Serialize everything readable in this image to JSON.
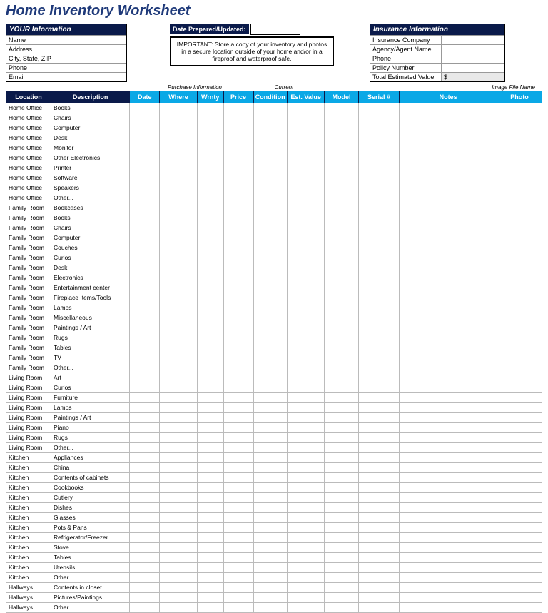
{
  "title": "Home Inventory Worksheet",
  "your_info": {
    "header": "YOUR Information",
    "rows": [
      {
        "label": "Name",
        "value": ""
      },
      {
        "label": "Address",
        "value": ""
      },
      {
        "label": "City, State, ZIP",
        "value": ""
      },
      {
        "label": "Phone",
        "value": ""
      },
      {
        "label": "Email",
        "value": ""
      }
    ]
  },
  "date_prepared_label": "Date Prepared/Updated:",
  "important": "IMPORTANT: Store a copy of your inventory and photos in a secure location outside of your home and/or in a fireproof and waterproof safe.",
  "insurance": {
    "header": "Insurance Information",
    "rows": [
      {
        "label": "Insurance Company",
        "value": ""
      },
      {
        "label": "Agency/Agent Name",
        "value": ""
      },
      {
        "label": "Phone",
        "value": ""
      },
      {
        "label": "Policy Number",
        "value": ""
      },
      {
        "label": "Total Estimated Value",
        "value": "$"
      }
    ]
  },
  "section_labels": {
    "purchase": "Purchase Information",
    "current": "Current",
    "image": "Image File Name"
  },
  "columns": [
    "Location",
    "Description",
    "Date",
    "Where",
    "Wrnty",
    "Price",
    "Condition",
    "Est. Value",
    "Model",
    "Serial #",
    "Notes",
    "Photo"
  ],
  "rows": [
    {
      "loc": "Home Office",
      "desc": "Books"
    },
    {
      "loc": "Home Office",
      "desc": "Chairs"
    },
    {
      "loc": "Home Office",
      "desc": "Computer"
    },
    {
      "loc": "Home Office",
      "desc": "Desk"
    },
    {
      "loc": "Home Office",
      "desc": "Monitor"
    },
    {
      "loc": "Home Office",
      "desc": "Other Electronics"
    },
    {
      "loc": "Home Office",
      "desc": "Printer"
    },
    {
      "loc": "Home Office",
      "desc": "Software"
    },
    {
      "loc": "Home Office",
      "desc": "Speakers"
    },
    {
      "loc": "Home Office",
      "desc": "Other..."
    },
    {
      "loc": "Family Room",
      "desc": "Bookcases"
    },
    {
      "loc": "Family Room",
      "desc": "Books"
    },
    {
      "loc": "Family Room",
      "desc": "Chairs"
    },
    {
      "loc": "Family Room",
      "desc": "Computer"
    },
    {
      "loc": "Family Room",
      "desc": "Couches"
    },
    {
      "loc": "Family Room",
      "desc": "Curios"
    },
    {
      "loc": "Family Room",
      "desc": "Desk"
    },
    {
      "loc": "Family Room",
      "desc": "Electronics"
    },
    {
      "loc": "Family Room",
      "desc": "Entertainment center"
    },
    {
      "loc": "Family Room",
      "desc": "Fireplace Items/Tools"
    },
    {
      "loc": "Family Room",
      "desc": "Lamps"
    },
    {
      "loc": "Family Room",
      "desc": "Miscellaneous"
    },
    {
      "loc": "Family Room",
      "desc": "Paintings / Art"
    },
    {
      "loc": "Family Room",
      "desc": "Rugs"
    },
    {
      "loc": "Family Room",
      "desc": "Tables"
    },
    {
      "loc": "Family Room",
      "desc": "TV"
    },
    {
      "loc": "Family Room",
      "desc": "Other..."
    },
    {
      "loc": "Living Room",
      "desc": "Art"
    },
    {
      "loc": "Living Room",
      "desc": "Curios"
    },
    {
      "loc": "Living Room",
      "desc": "Furniture"
    },
    {
      "loc": "Living Room",
      "desc": "Lamps"
    },
    {
      "loc": "Living Room",
      "desc": "Paintings / Art"
    },
    {
      "loc": "Living Room",
      "desc": "Piano"
    },
    {
      "loc": "Living Room",
      "desc": "Rugs"
    },
    {
      "loc": "Living Room",
      "desc": "Other..."
    },
    {
      "loc": "Kitchen",
      "desc": "Appliances"
    },
    {
      "loc": "Kitchen",
      "desc": "China"
    },
    {
      "loc": "Kitchen",
      "desc": "Contents of cabinets"
    },
    {
      "loc": "Kitchen",
      "desc": "Cookbooks"
    },
    {
      "loc": "Kitchen",
      "desc": "Cutlery"
    },
    {
      "loc": "Kitchen",
      "desc": "Dishes"
    },
    {
      "loc": "Kitchen",
      "desc": "Glasses"
    },
    {
      "loc": "Kitchen",
      "desc": "Pots & Pans"
    },
    {
      "loc": "Kitchen",
      "desc": "Refrigerator/Freezer"
    },
    {
      "loc": "Kitchen",
      "desc": "Stove"
    },
    {
      "loc": "Kitchen",
      "desc": "Tables"
    },
    {
      "loc": "Kitchen",
      "desc": "Utensils"
    },
    {
      "loc": "Kitchen",
      "desc": "Other..."
    },
    {
      "loc": "Hallways",
      "desc": "Contents in closet"
    },
    {
      "loc": "Hallways",
      "desc": "Pictures/Paintings"
    },
    {
      "loc": "Hallways",
      "desc": "Other..."
    }
  ]
}
